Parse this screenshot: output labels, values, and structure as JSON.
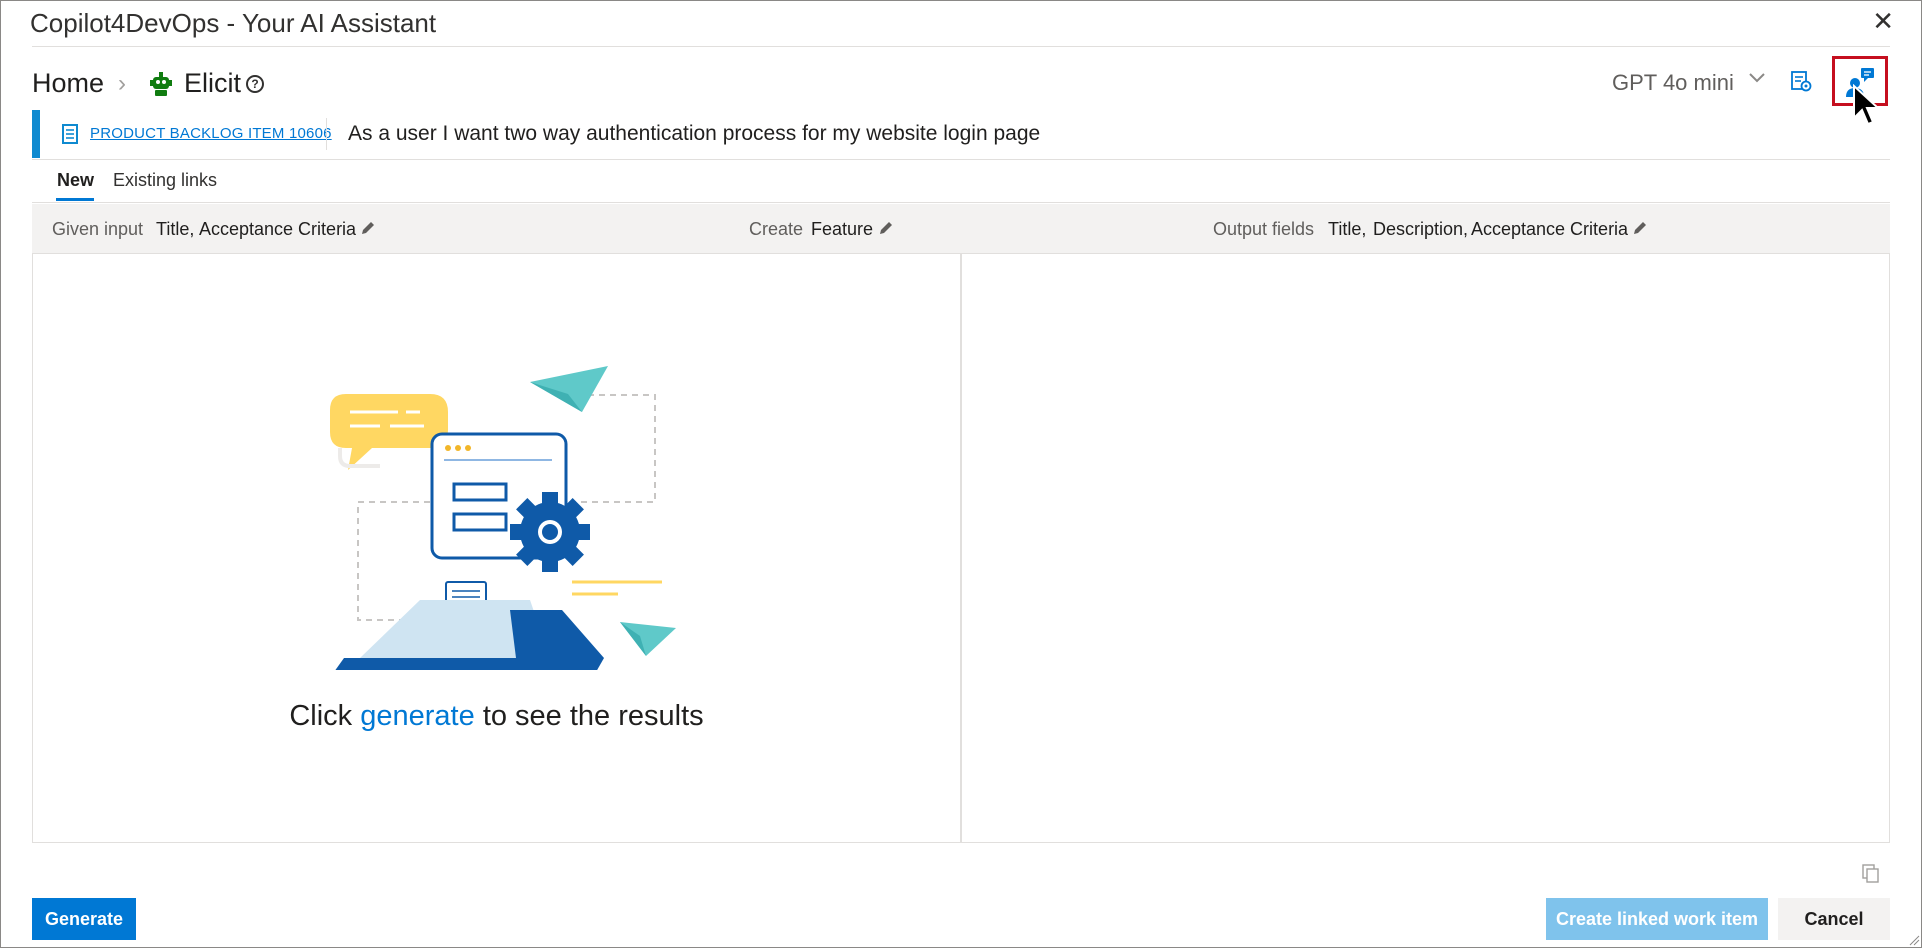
{
  "window": {
    "title": "Copilot4DevOps - Your AI Assistant",
    "close_icon": "close-icon"
  },
  "breadcrumb": {
    "home": "Home",
    "separator_icon": "chevron-right-icon",
    "app_icon": "elicit-robot-icon",
    "app": "Elicit",
    "help_icon": "help-circle-icon"
  },
  "toolbar": {
    "model": "GPT 4o mini",
    "model_dropdown_icon": "chevron-down-icon",
    "settings_icon": "prompt-settings-icon",
    "feedback_icon": "user-feedback-icon"
  },
  "work_item": {
    "icon": "backlog-item-icon",
    "link": "PRODUCT BACKLOG ITEM 10606",
    "title": "As a user I want two way authentication process for my website login page"
  },
  "tabs": [
    {
      "label": "New",
      "selected": true
    },
    {
      "label": "Existing links",
      "selected": false
    }
  ],
  "config": {
    "given_input_label": "Given input",
    "given_input_values": [
      "Title,",
      "Acceptance Criteria"
    ],
    "create_label": "Create",
    "create_value": "Feature",
    "output_label": "Output fields",
    "output_values": [
      "Title,",
      "Description,",
      "Acceptance Criteria"
    ],
    "edit_icon": "pencil-icon"
  },
  "empty_state": {
    "illustration": "chat-gear-illustration",
    "prefix": "Click",
    "link": "generate",
    "suffix": "to see the results"
  },
  "footer": {
    "copy_icon": "copy-icon",
    "generate": "Generate",
    "create_linked": "Create linked work item",
    "cancel": "Cancel"
  },
  "colors": {
    "accent": "#0078d4",
    "work_item_bar": "#0f8ad0",
    "disabled_primary": "#7fc3ec",
    "highlight_box": "#c50f1f"
  }
}
